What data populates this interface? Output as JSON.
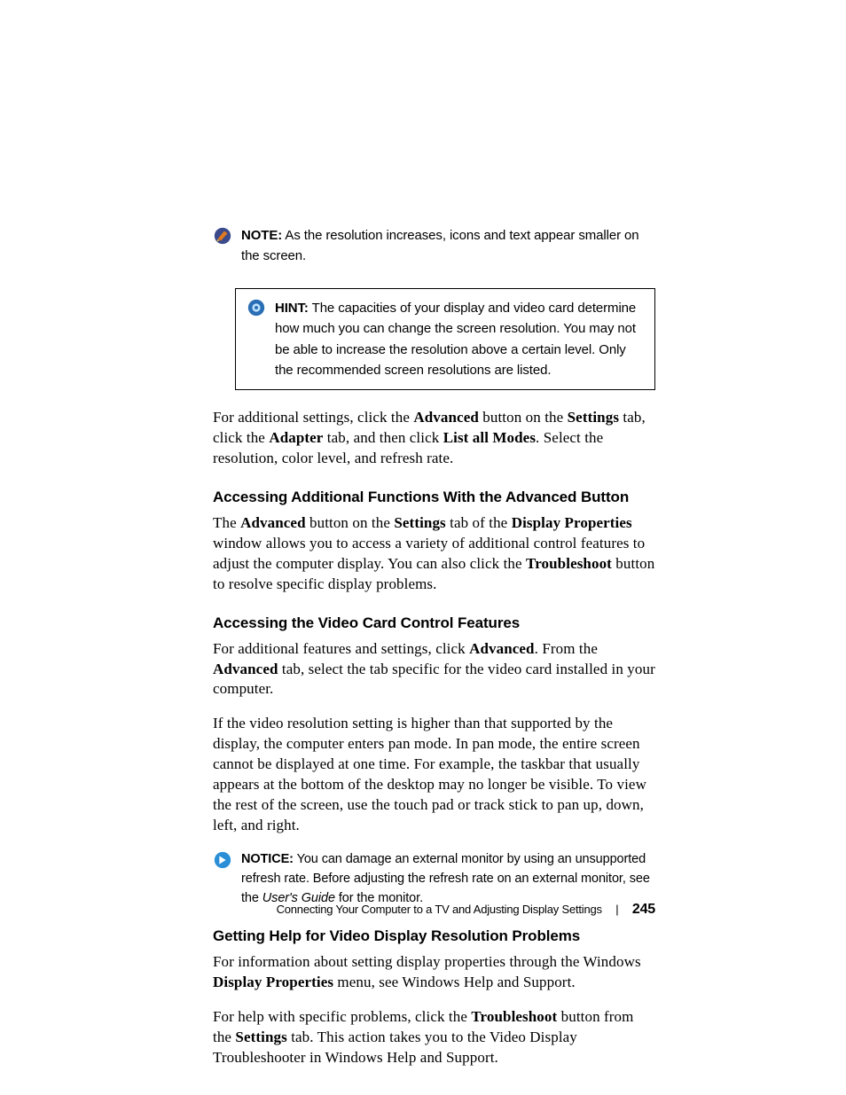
{
  "note": {
    "label": "NOTE:",
    "text": "As the resolution increases, icons and text appear smaller on the screen."
  },
  "hint": {
    "label": "HINT:",
    "text": "The capacities of your display and video card determine how much you can change the screen resolution. You may not be able to increase the resolution above a certain level. Only the recommended screen resolutions are listed."
  },
  "p1": {
    "pre": "For additional settings, click the ",
    "b1": "Advanced",
    "m1": " button on the ",
    "b2": "Settings",
    "m2": " tab, click the ",
    "b3": "Adapter",
    "m3": " tab, and then click ",
    "b4": "List all Modes",
    "post": ". Select the resolution, color level, and refresh rate."
  },
  "h1": "Accessing Additional Functions With the Advanced Button",
  "p2": {
    "pre": "The ",
    "b1": "Advanced",
    "m1": " button on the ",
    "b2": "Settings",
    "m2": " tab of the ",
    "b3": "Display Properties",
    "m3": " window allows you to access a variety of additional control features to adjust the computer display. You can also click the ",
    "b4": "Troubleshoot",
    "post": " button to resolve specific display problems."
  },
  "h2": "Accessing the Video Card Control Features",
  "p3": {
    "pre": "For additional features and settings, click ",
    "b1": "Advanced",
    "m1": ". From the ",
    "b2": "Advanced",
    "post": " tab, select the tab specific for the video card installed in your computer."
  },
  "p4": "If the video resolution setting is higher than that supported by the display, the computer enters pan mode. In pan mode, the entire screen cannot be displayed at one time. For example, the taskbar that usually appears at the bottom of the desktop may no longer be visible. To view the rest of the screen, use the touch pad or track stick to pan up, down, left, and right.",
  "notice": {
    "label": "NOTICE:",
    "pre": "You can damage an external monitor by using an unsupported refresh rate. Before adjusting the refresh rate on an external monitor, see the ",
    "i1": "User's Guide",
    "post": " for the monitor."
  },
  "h3": "Getting Help for Video Display Resolution Problems",
  "p5": {
    "pre": "For information about setting display properties through the Windows ",
    "b1": "Display Properties",
    "post": " menu, see Windows Help and Support."
  },
  "p6": {
    "pre": "For help with specific problems, click the ",
    "b1": "Troubleshoot",
    "m1": " button from the ",
    "b2": "Settings",
    "post": " tab. This action takes you to the Video Display Troubleshooter in Windows Help and Support."
  },
  "footer": {
    "title": "Connecting Your Computer to a TV and Adjusting Display Settings",
    "page": "245"
  }
}
